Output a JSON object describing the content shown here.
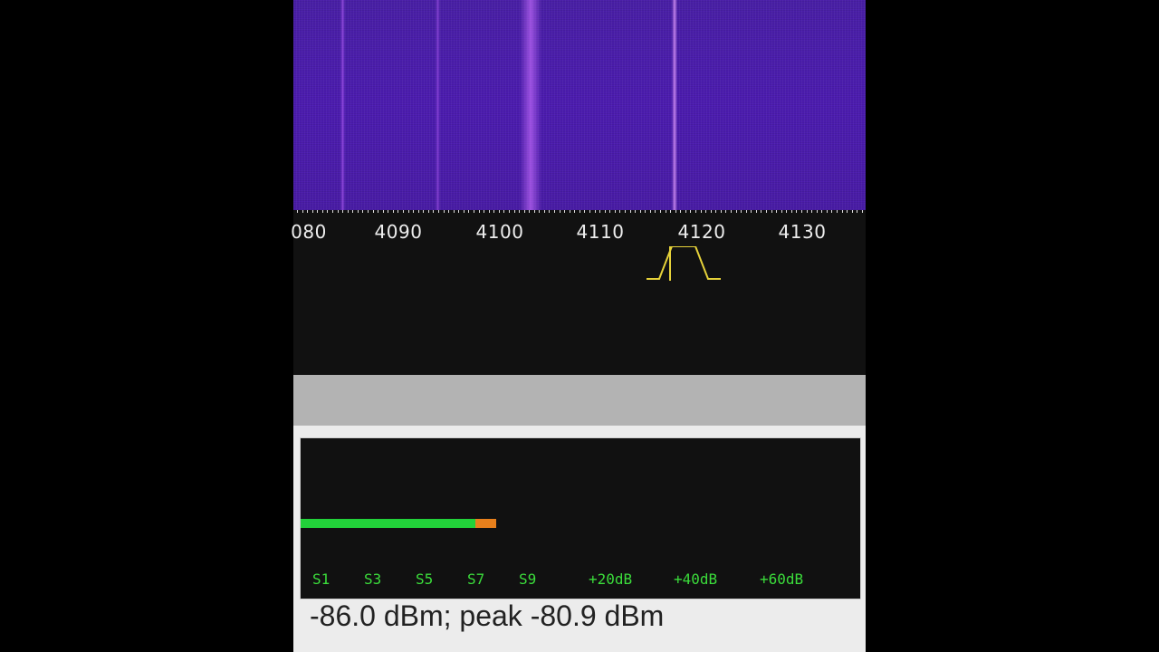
{
  "waterfall": {
    "colors": {
      "background": "#4b1eaa",
      "signal": "#c060ff"
    }
  },
  "frequency_scale": {
    "labels": [
      "080",
      "4090",
      "4100",
      "4110",
      "4120",
      "4130"
    ]
  },
  "passband": {
    "color": "#e6d23a"
  },
  "smeter": {
    "level_fraction": 0.312,
    "peak_fraction": 0.038,
    "scale_labels": [
      "S1",
      "S3",
      "S5",
      "S7",
      "S9",
      "+20dB",
      "+40dB",
      "+60dB"
    ],
    "colors": {
      "bar": "#22d23a",
      "peak": "#e8801c",
      "labels": "#3bdc3b"
    }
  },
  "readout": {
    "level": "-86.0 dBm;",
    "peak_label": "peak",
    "peak_value": "-80.9 dBm"
  }
}
